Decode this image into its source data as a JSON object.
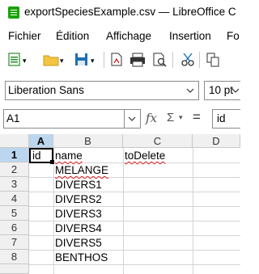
{
  "window": {
    "title": "exportSpeciesExample.csv — LibreOffice C"
  },
  "menu": [
    "Fichier",
    "Édition",
    "Affichage",
    "Insertion",
    "Fo"
  ],
  "toolbar": {
    "font_name": "Liberation Sans",
    "font_size": "10 pt"
  },
  "formula_bar": {
    "cell_ref": "A1",
    "content": "id"
  },
  "sheet": {
    "columns": [
      "A",
      "B",
      "C",
      "D"
    ],
    "rows": [
      {
        "num": "1",
        "a": "id",
        "b": "name",
        "c": "toDelete"
      },
      {
        "num": "2",
        "a": "",
        "b": "MELANGE",
        "c": ""
      },
      {
        "num": "3",
        "a": "",
        "b": "DIVERS1",
        "c": ""
      },
      {
        "num": "4",
        "a": "",
        "b": "DIVERS2",
        "c": ""
      },
      {
        "num": "5",
        "a": "",
        "b": "DIVERS3",
        "c": ""
      },
      {
        "num": "6",
        "a": "",
        "b": "DIVERS4",
        "c": ""
      },
      {
        "num": "7",
        "a": "",
        "b": "DIVERS5",
        "c": ""
      },
      {
        "num": "8",
        "a": "",
        "b": "BENTHOS",
        "c": ""
      }
    ]
  },
  "colors": {
    "selection": "#bcd6ef",
    "app_icon": "#18a303",
    "squiggle": "#e02020"
  }
}
